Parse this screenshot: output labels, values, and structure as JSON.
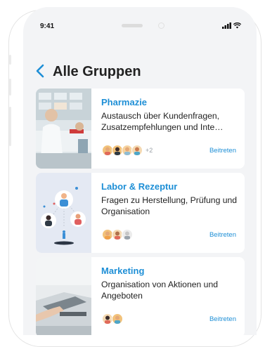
{
  "status_bar": {
    "time": "9:41",
    "signal_icon": "signal-icon",
    "wifi_icon": "wifi-icon"
  },
  "header": {
    "title": "Alle Gruppen",
    "back_icon": "chevron-left-icon"
  },
  "groups": [
    {
      "title": "Pharmazie",
      "description": "Austausch über Kundenfragen, Zusatzempfehlungen und Inte…",
      "extra_members": "+2",
      "join_label": "Beitreten",
      "thumb": "pharmacy-photo"
    },
    {
      "title": "Labor & Rezeptur",
      "description": "Fragen zu Herstellung, Prüfung und Organisation",
      "extra_members": "",
      "join_label": "Beitreten",
      "thumb": "team-illustration"
    },
    {
      "title": "Marketing",
      "description": "Organisation von Aktionen und Angeboten",
      "extra_members": "",
      "join_label": "Beitreten",
      "thumb": "laptop-photo"
    }
  ],
  "colors": {
    "accent": "#1e8fd6",
    "background": "#f3f4f6"
  }
}
